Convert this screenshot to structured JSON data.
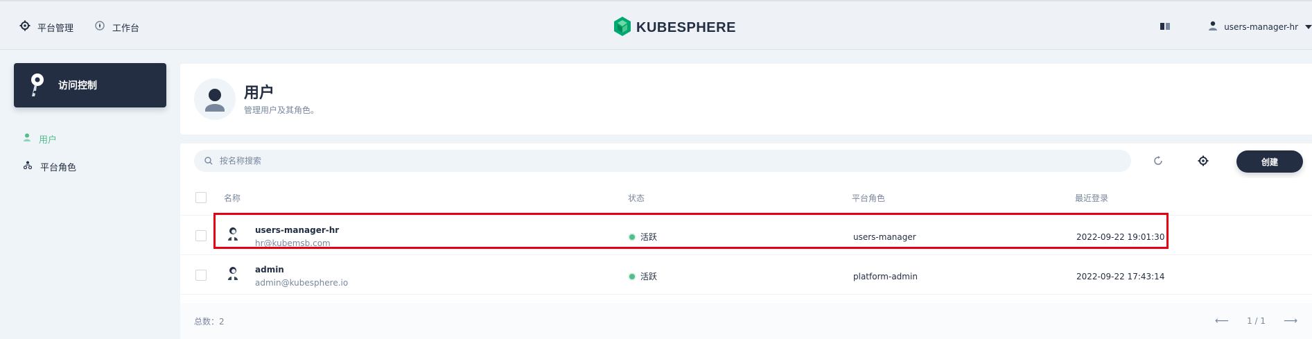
{
  "header": {
    "nav": [
      {
        "label": "平台管理",
        "icon": "gear-icon"
      },
      {
        "label": "工作台",
        "icon": "workbench-icon"
      }
    ],
    "logo_text": "KUBESPHERE",
    "user": "users-manager-hr"
  },
  "sidebar": {
    "card_title": "访问控制",
    "items": [
      {
        "label": "用户",
        "active": true
      },
      {
        "label": "平台角色",
        "active": false
      }
    ]
  },
  "page": {
    "title": "用户",
    "description": "管理用户及其角色。"
  },
  "toolbar": {
    "search_placeholder": "按名称搜索",
    "create_label": "创建"
  },
  "table": {
    "columns": [
      "名称",
      "状态",
      "平台角色",
      "最近登录"
    ],
    "rows": [
      {
        "name": "users-manager-hr",
        "email": "hr@kubemsb.com",
        "status": "活跃",
        "role": "users-manager",
        "last_login": "2022-09-22 19:01:30"
      },
      {
        "name": "admin",
        "email": "admin@kubesphere.io",
        "status": "活跃",
        "role": "platform-admin",
        "last_login": "2022-09-22 17:43:14"
      }
    ]
  },
  "footer": {
    "total": "总数：2",
    "page": "1 / 1"
  },
  "colors": {
    "primary_dark": "#242e42",
    "accent_green": "#55bc8a",
    "highlight_red": "#e60012",
    "muted_text": "#79879c"
  }
}
